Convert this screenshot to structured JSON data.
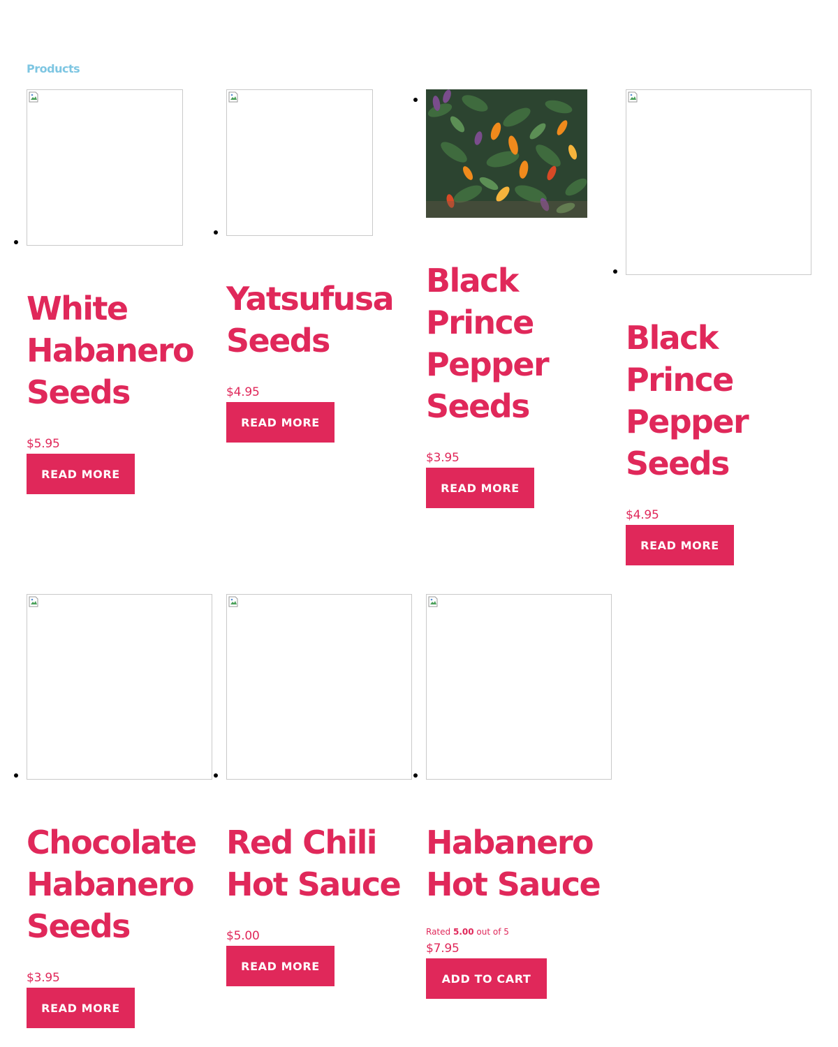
{
  "breadcrumb": {
    "label": "Products"
  },
  "colors": {
    "accent": "#e0285a",
    "link": "#7ec6e2"
  },
  "products": [
    {
      "title": "White Habanero Seeds",
      "price": "$5.95",
      "button": "READ MORE"
    },
    {
      "title": "Yatsufusa Seeds",
      "price": "$4.95",
      "button": "READ MORE"
    },
    {
      "title": "Black Prince Pepper Seeds",
      "price": "$3.95",
      "button": "READ MORE"
    },
    {
      "title": "Black Prince Pepper Seeds",
      "price": "$4.95",
      "button": "READ MORE"
    },
    {
      "title": "Chocolate Habanero Seeds",
      "price": "$3.95",
      "button": "READ MORE"
    },
    {
      "title": "Red Chili Hot Sauce",
      "price": "$5.00",
      "button": "READ MORE"
    },
    {
      "title": "Habanero Hot Sauce",
      "price": "$7.95",
      "button": "ADD TO CART",
      "rating": {
        "prefix": "Rated",
        "value": "5.00",
        "suffix": "out of 5"
      }
    }
  ]
}
